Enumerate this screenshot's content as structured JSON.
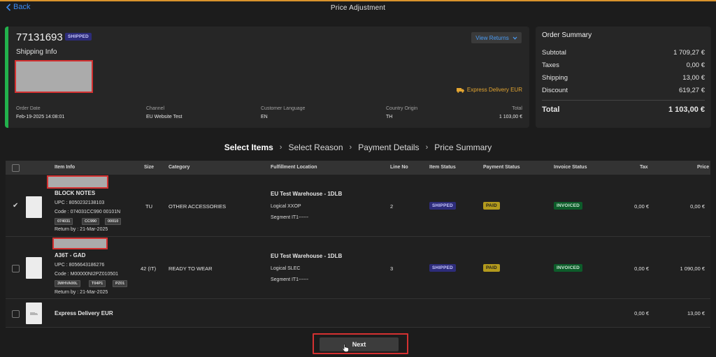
{
  "header": {
    "back_label": "Back",
    "title": "Price Adjustment"
  },
  "order": {
    "id": "77131693",
    "status": "SHIPPED",
    "shipping_info_label": "Shipping Info",
    "view_returns_label": "View Returns",
    "delivery_method": "Express Delivery EUR",
    "meta": [
      {
        "label": "Order Date",
        "value": "Feb-19-2025 14:08:01"
      },
      {
        "label": "Channel",
        "value": "EU Website Test"
      },
      {
        "label": "Customer Language",
        "value": "EN"
      },
      {
        "label": "Country Origin",
        "value": "TH"
      },
      {
        "label": "Total",
        "value": "1 103,00 €"
      }
    ]
  },
  "summary": {
    "title": "Order Summary",
    "rows": [
      {
        "label": "Subtotal",
        "value": "1 709,27 €"
      },
      {
        "label": "Taxes",
        "value": "0,00 €"
      },
      {
        "label": "Shipping",
        "value": "13,00 €"
      },
      {
        "label": "Discount",
        "value": "619,27 €"
      }
    ],
    "total_label": "Total",
    "total_value": "1 103,00 €"
  },
  "steps": [
    "Select Items",
    "Select Reason",
    "Payment Details",
    "Price Summary"
  ],
  "table": {
    "columns": [
      "Item Info",
      "Size",
      "Category",
      "Fulfillment Location",
      "Line No",
      "Item Status",
      "Payment Status",
      "Invoice Status",
      "Tax",
      "Price"
    ],
    "rows": [
      {
        "name": "BLOCK NOTES",
        "upc": "UPC : 8050232138103",
        "code": "Code : 074031CC990 00101N",
        "chips": [
          "074031",
          "CC990",
          "00010"
        ],
        "return_by": "Return by : 21-Mar-2025",
        "size": "TU",
        "category": "OTHER ACCESSORIES",
        "warehouse": "EU Test Warehouse - 1DLB",
        "logical": "Logical XXOP",
        "segment": "Segment IT1------",
        "line_no": "2",
        "item_status": "SHIPPED",
        "payment_status": "PAID",
        "invoice_status": "INVOICED",
        "tax": "0,00 €",
        "price": "0,00 €",
        "checked": true
      },
      {
        "name": "A36T - GAD",
        "upc": "UPC : 8056643186276",
        "code": "Code : M00000NI2PZ010501",
        "chips": [
          "3WHVA00L",
          "T04P1",
          "PZ01"
        ],
        "return_by": "Return by : 21-Mar-2025",
        "size": "42 (IT)",
        "category": "READY TO WEAR",
        "warehouse": "EU Test Warehouse - 1DLB",
        "logical": "Logical SLEC",
        "segment": "Segment IT1------",
        "line_no": "3",
        "item_status": "SHIPPED",
        "payment_status": "PAID",
        "invoice_status": "INVOICED",
        "tax": "0,00 €",
        "price": "1 090,00 €",
        "checked": false
      }
    ],
    "shipping_row": {
      "name": "Express Delivery EUR",
      "tax": "0,00 €",
      "price": "13,00 €"
    }
  },
  "next_label": "Next",
  "colors": {
    "accent_green": "#22b14c",
    "link_blue": "#3d8bf2",
    "top_orange": "#d9932c",
    "redaction_border": "#d43131"
  }
}
